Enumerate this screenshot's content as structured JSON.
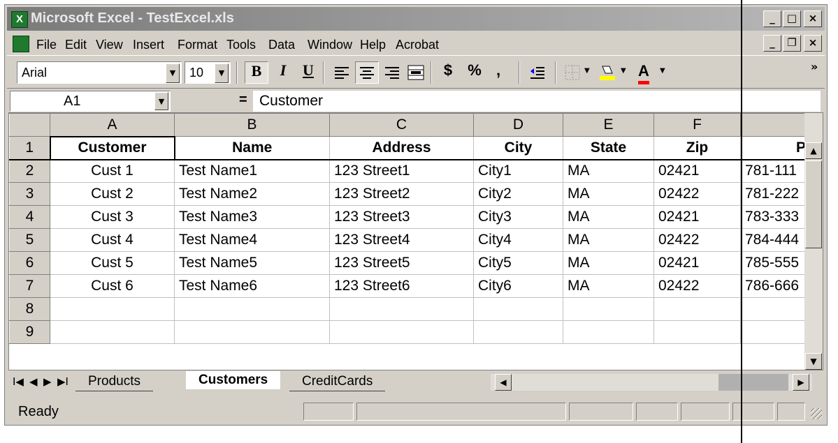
{
  "window": {
    "title": "Microsoft Excel - TestExcel.xls",
    "app_icon_glyph": "X",
    "caption_buttons": [
      "_",
      "□",
      "×"
    ],
    "doc_caption_buttons": [
      "_",
      "❐",
      "×"
    ]
  },
  "menubar": {
    "items": [
      "File",
      "Edit",
      "View",
      "Insert",
      "Format",
      "Tools",
      "Data",
      "Window",
      "Help",
      "Acrobat"
    ]
  },
  "toolbar": {
    "font_name": "Arial",
    "font_size": "10",
    "bold": "B",
    "italic": "I",
    "underline": "U",
    "currency": "$",
    "percent": "%",
    "comma": ",",
    "font_color_letter": "A",
    "more": "»",
    "icons": [
      "align-left-icon",
      "center-icon",
      "align-right-icon",
      "merge-center-icon",
      "decrease-indent-icon",
      "borders-icon",
      "fill-color-icon",
      "font-color-icon"
    ],
    "colors": {
      "fill_color": "#ffff00",
      "font_color": "#ff0000"
    }
  },
  "formula_bar": {
    "name_box": "A1",
    "equals": "=",
    "content": "Customer"
  },
  "sheet": {
    "columns": [
      "A",
      "B",
      "C",
      "D",
      "E",
      "F",
      ""
    ],
    "row_numbers": [
      "1",
      "2",
      "3",
      "4",
      "5",
      "6",
      "7",
      "8",
      "9"
    ],
    "header": [
      "Customer",
      "Name",
      "Address",
      "City",
      "State",
      "Zip",
      "P"
    ],
    "rows": [
      [
        "Cust 1",
        "Test Name1",
        "123 Street1",
        "City1",
        "MA",
        "02421",
        "781-111"
      ],
      [
        "Cust 2",
        "Test Name2",
        "123 Street2",
        "City2",
        "MA",
        "02422",
        "781-222"
      ],
      [
        "Cust 3",
        "Test Name3",
        "123 Street3",
        "City3",
        "MA",
        "02421",
        "783-333"
      ],
      [
        "Cust 4",
        "Test Name4",
        "123 Street4",
        "City4",
        "MA",
        "02422",
        "784-444"
      ],
      [
        "Cust 5",
        "Test Name5",
        "123 Street5",
        "City5",
        "MA",
        "02421",
        "785-555"
      ],
      [
        "Cust 6",
        "Test Name6",
        "123 Street6",
        "City6",
        "MA",
        "02422",
        "786-666"
      ],
      [
        "",
        "",
        "",
        "",
        "",
        "",
        ""
      ],
      [
        "",
        "",
        "",
        "",
        "",
        "",
        ""
      ]
    ]
  },
  "sheet_tabs": {
    "tabs": [
      "Products",
      "Customers",
      "CreditCards"
    ],
    "active": "Customers",
    "nav": [
      "I◀",
      "◀",
      "▶",
      "▶I"
    ]
  },
  "statusbar": {
    "text": "Ready"
  }
}
